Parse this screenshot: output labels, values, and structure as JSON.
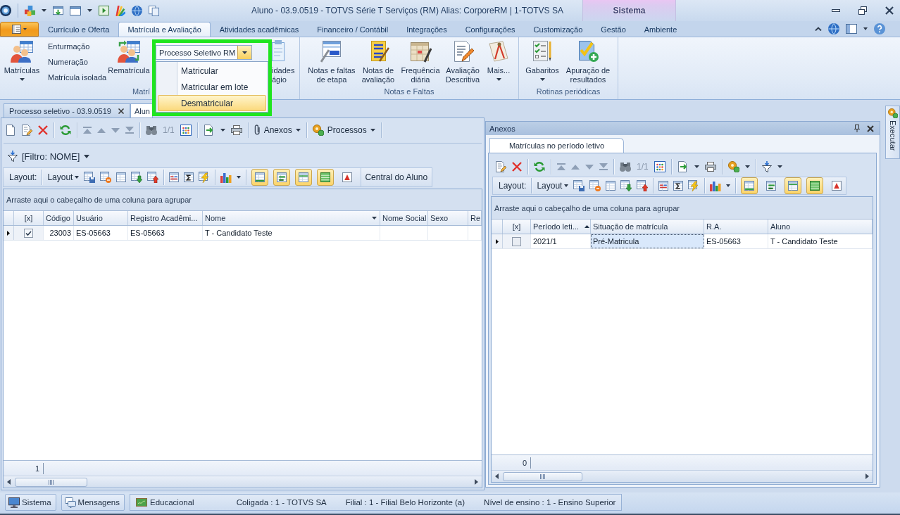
{
  "title_bar": {
    "title": "Aluno - 03.9.0519 - TOTVS Série T Serviços (RM) Alias: CorporeRM | 1-TOTVS SA",
    "context_tab": "Sistema"
  },
  "ribbon": {
    "tabs": [
      {
        "label": "Currículo e Oferta",
        "selected": false
      },
      {
        "label": "Matrícula e Avaliação",
        "selected": true
      },
      {
        "label": "Atividades acadêmicas",
        "selected": false
      },
      {
        "label": "Financeiro / Contábil",
        "selected": false
      },
      {
        "label": "Integrações",
        "selected": false
      },
      {
        "label": "Configurações",
        "selected": false
      },
      {
        "label": "Customização",
        "selected": false
      },
      {
        "label": "Gestão",
        "selected": false
      },
      {
        "label": "Ambiente",
        "selected": false
      }
    ],
    "groups": [
      {
        "label": "Matrí",
        "items": [
          {
            "kind": "large",
            "label": "Matrículas",
            "dropdown": true
          },
          {
            "kind": "stack",
            "entries": [
              "Enturmação",
              "Numeração",
              "Matrícula isolada"
            ]
          },
          {
            "kind": "large",
            "label": "Rematrícula",
            "dropdown": false
          },
          {
            "kind": "covered",
            "label": "idades ágio"
          }
        ]
      },
      {
        "label": "Notas e Faltas",
        "items": [
          {
            "kind": "large",
            "label": "Notas e faltas de etapa",
            "dropdown": false
          },
          {
            "kind": "large",
            "label": "Notas de avaliação",
            "dropdown": false
          },
          {
            "kind": "large",
            "label": "Frequência diária",
            "dropdown": false
          },
          {
            "kind": "large",
            "label": "Avaliação Descritiva",
            "dropdown": false
          },
          {
            "kind": "large",
            "label": "Mais...",
            "dropdown": true
          }
        ]
      },
      {
        "label": "Rotinas periódicas",
        "items": [
          {
            "kind": "large",
            "label": "Gabaritos",
            "dropdown": true
          },
          {
            "kind": "large",
            "label": "Apuração de resultados",
            "dropdown": false
          }
        ]
      }
    ]
  },
  "popup": {
    "combo_value": "Processo Seletivo RM",
    "menu": [
      {
        "label": "Matricular",
        "selected": false
      },
      {
        "label": "Matricular em lote",
        "selected": false
      },
      {
        "label": "Desmatricular",
        "selected": true
      }
    ]
  },
  "document_tabs": [
    {
      "label": "Processo seletivo - 03.9.0519",
      "selected": false,
      "closable": true
    },
    {
      "label": "Alun",
      "selected": true,
      "closable": false
    }
  ],
  "side_tab": {
    "label": "Executar"
  },
  "main_pane": {
    "toolbar": {
      "position": "1/1",
      "buttons": [
        "Anexos",
        "Processos"
      ]
    },
    "filter": "[Filtro: NOME]",
    "layout_bar": {
      "label": "Layout:",
      "menu": "Layout",
      "toggles": [
        {
          "on": true
        },
        {
          "on": true
        },
        {
          "on": true
        },
        {
          "on": true
        },
        {
          "on": false
        }
      ],
      "button": "Central do Aluno"
    },
    "grid": {
      "group_hint": "Arraste aqui o cabeçalho de uma coluna para agrupar",
      "columns": [
        {
          "label": "[x]",
          "filter": false
        },
        {
          "label": "Código",
          "filter": false
        },
        {
          "label": "Usuário",
          "filter": false
        },
        {
          "label": "Registro Acadêmi...",
          "filter": false
        },
        {
          "label": "Nome",
          "filter": true
        },
        {
          "label": "Nome Social",
          "filter": false
        },
        {
          "label": "Sexo",
          "filter": false
        },
        {
          "label": "Re",
          "filter": false
        }
      ],
      "rows": [
        {
          "current": true,
          "checked": true,
          "cells": [
            "",
            "23003",
            "ES-05663",
            "ES-05663",
            "T - Candidato Teste"
          ]
        }
      ],
      "count": "1"
    }
  },
  "attachments_pane": {
    "title": "Anexos",
    "tabs": [
      {
        "label": "Matrículas no período letivo",
        "selected": true
      }
    ],
    "toolbar": {
      "position": "1/1"
    },
    "layout_bar": {
      "label": "Layout:",
      "menu": "Layout",
      "toggles": [
        {
          "on": true
        },
        {
          "on": false
        },
        {
          "on": true
        },
        {
          "on": true
        },
        {
          "on": false
        }
      ]
    },
    "grid": {
      "group_hint": "Arraste aqui o cabeçalho de uma coluna para agrupar",
      "columns": [
        {
          "label": "[x]",
          "sorted": false
        },
        {
          "label": "Período leti...",
          "sorted": true
        },
        {
          "label": "Situação de matrícula",
          "sorted": false
        },
        {
          "label": "R.A.",
          "sorted": false
        },
        {
          "label": "Aluno",
          "sorted": false
        }
      ],
      "rows": [
        {
          "current": true,
          "checked": false,
          "cells": [
            "",
            {
              "text": "2021/1",
              "focused": false
            },
            {
              "text": "Pré-Matricula",
              "focused": true
            },
            {
              "text": "ES-05663",
              "focused": false
            },
            {
              "text": "T - Candidato Teste",
              "focused": false
            }
          ]
        }
      ],
      "count": "0"
    }
  },
  "status_bar": {
    "buttons": [
      "Sistema",
      "Mensagens"
    ],
    "module": "Educacional",
    "fields": [
      "Coligada : 1 - TOTVS SA",
      "Filial : 1 - Filial Belo Horizonte (a)",
      "Nível de ensino : 1 - Ensino Superior"
    ]
  }
}
